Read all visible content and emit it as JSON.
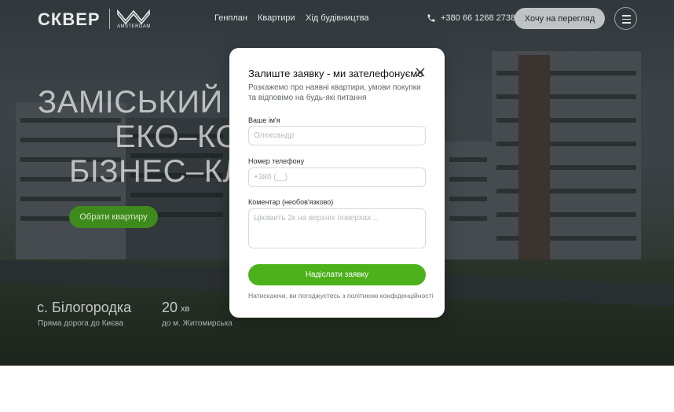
{
  "header": {
    "logo_text": "СКВЕР",
    "logo_sub": "AMSTERDAM",
    "nav": [
      "Генплан",
      "Квартири",
      "Хід будівництва"
    ],
    "phone": "+380 66 1268 2738",
    "cta": "Хочу на перегляд",
    "icons": {
      "phone": "phone-icon",
      "menu": "menu-icon"
    }
  },
  "hero": {
    "headline": [
      "ЗАМІСЬКИЙ",
      "ЕКО–КОМ",
      "БІЗНЕС–КЛА"
    ],
    "choose_button": "Обрати квартиру",
    "location": {
      "title": "с. Білогородка",
      "subtitle": "Пряма дорога до Києва"
    },
    "travel": {
      "value": "20",
      "unit": "хв",
      "subtitle": "до м. Житомирська"
    }
  },
  "modal": {
    "title": "Залиште заявку - ми зателефонуємо",
    "description": "Розкажемо про наявні квартири, умови покупки та відповімо на будь-які питання",
    "fields": [
      {
        "label": "Ваше ім'я",
        "placeholder": "Олександр",
        "value": ""
      },
      {
        "label": "Номер телефону",
        "placeholder": "+380 (__)",
        "value": ""
      },
      {
        "label": "Коментар (необов'язково)",
        "placeholder": "Цікавить 2к на верхніх поверхах...",
        "value": ""
      }
    ],
    "submit": "Надіслати заявку",
    "consent": "Натискаючи, ви погоджуєтесь з політикою конфіденційності",
    "close_icon": "close-icon"
  },
  "colors": {
    "accent_green": "#4cb11a",
    "button_green_dim": "#3f8a1c",
    "header_cta_bg": "#bfc3c4"
  }
}
